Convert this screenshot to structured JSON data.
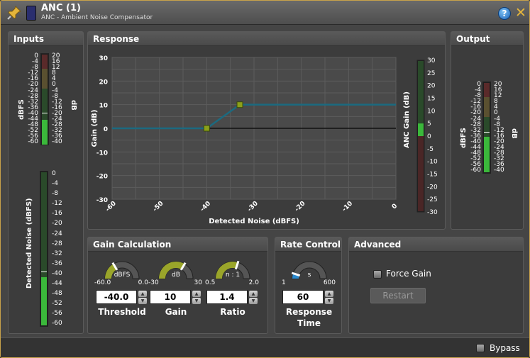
{
  "window": {
    "title": "ANC (1)",
    "subtitle": "ANC - Ambient Noise Compensator"
  },
  "inputs": {
    "title": "Inputs",
    "dbfs_label": "dBFS",
    "db_label": "dB",
    "noise_label": "Detected Noise (dBFS)",
    "scale_left": [
      "0",
      "-4",
      "-8",
      "-12",
      "-16",
      "-20",
      "-24",
      "-28",
      "-32",
      "-36",
      "-40",
      "-44",
      "-48",
      "-52",
      "-56",
      "-60"
    ],
    "scale_right": [
      "20",
      "16",
      "12",
      "8",
      "4",
      "0",
      "-4",
      "-8",
      "-12",
      "-16",
      "-20",
      "-24",
      "-28",
      "-32",
      "-36",
      "-40"
    ],
    "noise_scale": [
      "0",
      "-4",
      "-8",
      "-12",
      "-16",
      "-20",
      "-24",
      "-28",
      "-32",
      "-36",
      "-40",
      "-44",
      "-48",
      "-52",
      "-56",
      "-60"
    ]
  },
  "response": {
    "title": "Response"
  },
  "output": {
    "title": "Output",
    "dbfs_label": "dBFS",
    "db_label": "dB",
    "scale_left": [
      "0",
      "-4",
      "-8",
      "-12",
      "-16",
      "-20",
      "-24",
      "-28",
      "-32",
      "-36",
      "-40",
      "-44",
      "-48",
      "-52",
      "-56",
      "-60"
    ],
    "scale_right": [
      "20",
      "16",
      "12",
      "8",
      "4",
      "0",
      "-4",
      "-8",
      "-12",
      "-16",
      "-20",
      "-24",
      "-28",
      "-32",
      "-36",
      "-40"
    ]
  },
  "gain_calc": {
    "title": "Gain Calculation",
    "knobs": [
      {
        "unit": "dBFS",
        "min": "-60.0",
        "max": "0.0",
        "value": "-40.0",
        "label": "Threshold",
        "fraction": 0.33
      },
      {
        "unit": "dB",
        "min": "-30",
        "max": "30",
        "value": "10",
        "label": "Gain",
        "fraction": 0.67
      },
      {
        "unit": "n : 1",
        "min": "0.5",
        "max": "2.0",
        "value": "1.4",
        "label": "Ratio",
        "fraction": 0.6
      }
    ]
  },
  "rate": {
    "title": "Rate Control",
    "knob": {
      "unit": "s",
      "min": "1",
      "max": "600",
      "value": "60",
      "label1": "Response",
      "label2": "Time",
      "fraction": 0.1
    }
  },
  "advanced": {
    "title": "Advanced",
    "force_gain": "Force Gain",
    "restart": "Restart"
  },
  "status": {
    "bypass": "Bypass"
  },
  "chart_data": {
    "type": "line",
    "xlabel": "Detected Noise (dBFS)",
    "ylabel": "Gain (dB)",
    "xlim": [
      -60,
      0
    ],
    "ylim": [
      -30,
      30
    ],
    "xticks": [
      "-60",
      "-50",
      "-40",
      "-30",
      "-20",
      "-10",
      "0"
    ],
    "yticks": [
      "30",
      "20",
      "10",
      "0",
      "-10",
      "-20",
      "-30"
    ],
    "series": [
      {
        "values": [
          [
            -60,
            0
          ],
          [
            -40,
            0
          ],
          [
            -33,
            10
          ],
          [
            0,
            10
          ]
        ]
      }
    ],
    "handles": [
      [
        -40,
        0
      ],
      [
        -33,
        10
      ]
    ],
    "anc_gain": {
      "label": "ANC Gain (dB)",
      "scale": [
        "30",
        "25",
        "20",
        "15",
        "10",
        "5",
        "0",
        "-5",
        "-10",
        "-15",
        "-20",
        "-25",
        "-30"
      ],
      "value": 5
    }
  },
  "colors": {
    "accent": "#c8a24a",
    "line": "#1b6a80",
    "handle": "#8ba01a",
    "meter_green": "#3bb83b"
  }
}
